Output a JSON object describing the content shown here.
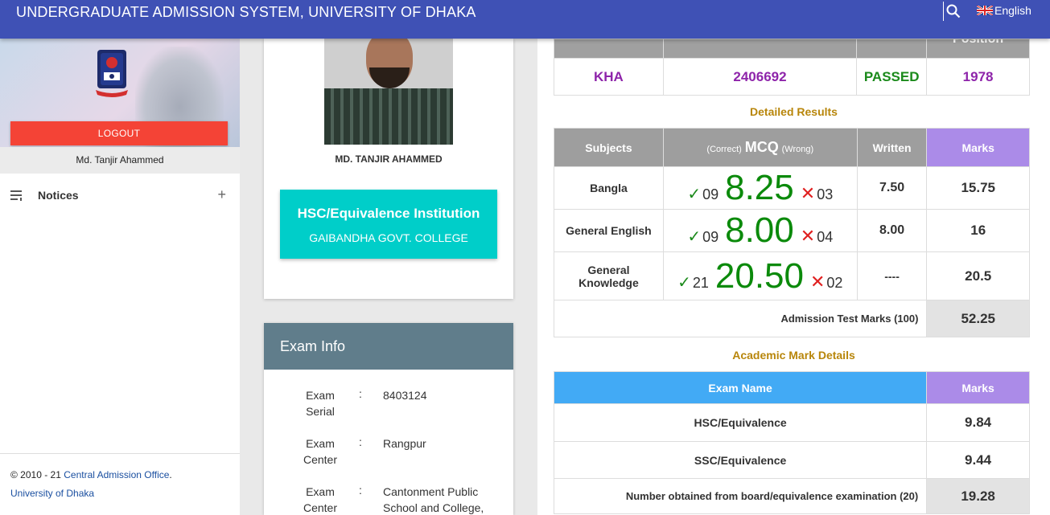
{
  "topbar": {
    "title": "UNDERGRADUATE ADMISSION SYSTEM, UNIVERSITY OF DHAKA",
    "language": "English"
  },
  "sidebar": {
    "logout_label": "LOGOUT",
    "user_name": "Md. Tanjir Ahammed",
    "notices_label": "Notices",
    "footer": {
      "prefix": "© 2010 - 21",
      "office": "Central Admission Office",
      "university": "University of Dhaka"
    }
  },
  "profile": {
    "name": "MD. TANJIR AHAMMED",
    "institution_heading": "HSC/Equivalence Institution",
    "institution_name": "GAIBANDHA GOVT. COLLEGE"
  },
  "exam_info": {
    "heading": "Exam Info",
    "rows": [
      {
        "key": "Exam Serial",
        "value": "8403124"
      },
      {
        "key": "Exam Center",
        "value": "Rangpur"
      },
      {
        "key": "Exam Center",
        "value": "Cantonment Public School and College,"
      }
    ]
  },
  "summary": {
    "headers": [
      "",
      "",
      "",
      "Position"
    ],
    "unit": "KHA",
    "roll": "2406692",
    "status": "PASSED",
    "position": "1978"
  },
  "detailed_results": {
    "title": "Detailed Results",
    "headers": {
      "subjects": "Subjects",
      "mcq_pre": "(Correct)",
      "mcq": "MCQ",
      "mcq_post": "(Wrong)",
      "written": "Written",
      "marks": "Marks"
    },
    "rows": [
      {
        "subject": "Bangla",
        "correct": "09",
        "mcq": "8.25",
        "wrong": "03",
        "written": "7.50",
        "marks": "15.75"
      },
      {
        "subject": "General English",
        "correct": "09",
        "mcq": "8.00",
        "wrong": "04",
        "written": "8.00",
        "marks": "16"
      },
      {
        "subject": "General Knowledge",
        "correct": "21",
        "mcq": "20.50",
        "wrong": "02",
        "written": "----",
        "marks": "20.5"
      }
    ],
    "total_label": "Admission Test Marks (100)",
    "total_value": "52.25"
  },
  "academic": {
    "title": "Academic Mark Details",
    "headers": {
      "exam": "Exam Name",
      "marks": "Marks"
    },
    "rows": [
      {
        "exam": "HSC/Equivalence",
        "marks": "9.84"
      },
      {
        "exam": "SSC/Equivalence",
        "marks": "9.44"
      }
    ],
    "total_label": "Number obtained from board/equivalence examination (20)",
    "total_value": "19.28"
  }
}
